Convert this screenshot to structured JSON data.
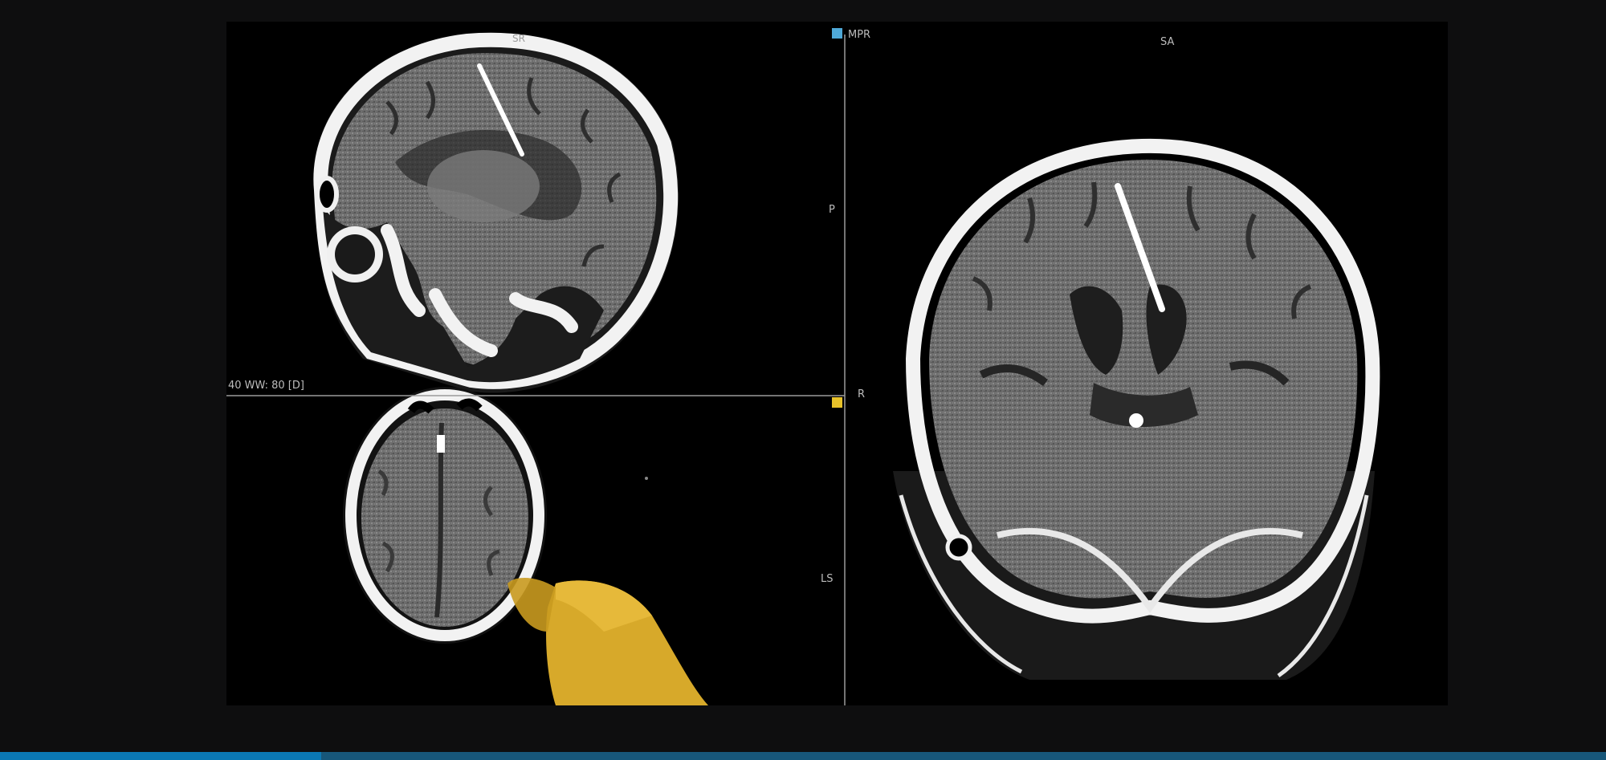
{
  "viewer": {
    "labels": {
      "sagittal_top": "SR",
      "mpr_tag": "MPR",
      "coronal_top": "SA",
      "side_p": "P",
      "side_r": "R",
      "side_ls": "LS",
      "window_level": "40 WW: 80 [D]"
    },
    "colors": {
      "mpr_marker": "#4fa9d8",
      "crosshair_marker": "#e8c22a",
      "crosshair_line": "#b0b0b0",
      "tool_overlay": "#d7a92a"
    }
  },
  "footer": {
    "progress": 0.2
  }
}
